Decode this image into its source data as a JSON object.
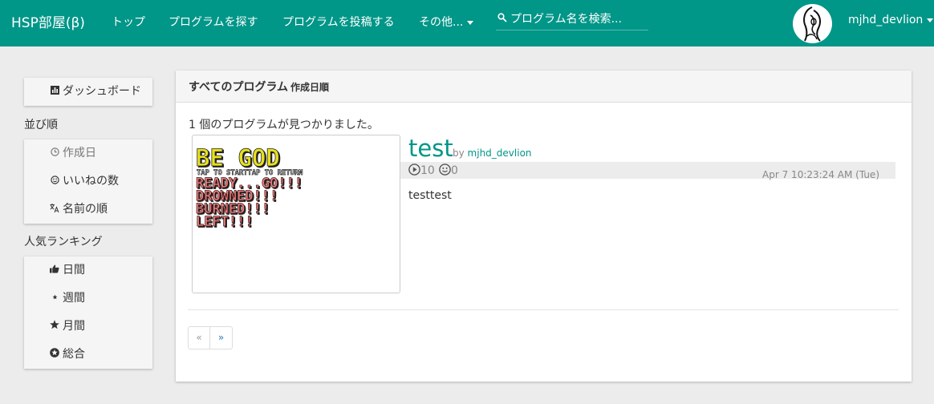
{
  "navbar": {
    "brand": "HSP部屋(β)",
    "links": [
      "トップ",
      "プログラムを探す",
      "プログラムを投稿する",
      "その他..."
    ],
    "search_placeholder": "プログラム名を検索...",
    "username": "mjhd_devlion"
  },
  "sidebar": {
    "dashboard": "ダッシュボード",
    "sort_heading": "並び順",
    "sort_items": [
      {
        "label": "作成日",
        "icon": "clock-icon"
      },
      {
        "label": "いいねの数",
        "icon": "smiley-icon"
      },
      {
        "label": "名前の順",
        "icon": "translate-icon"
      }
    ],
    "ranking_heading": "人気ランキング",
    "ranking_items": [
      {
        "label": "日間",
        "icon": "thumbs-up-icon"
      },
      {
        "label": "週間",
        "icon": "small-star-icon"
      },
      {
        "label": "月間",
        "icon": "star-icon"
      },
      {
        "label": "総合",
        "icon": "badge-star-icon"
      }
    ]
  },
  "main": {
    "title": "すべてのプログラム",
    "subtitle": "作成日順",
    "result_count": "1 個のプログラムが見つかりました。",
    "program": {
      "title": "test",
      "by": "by",
      "author": "mjhd_devlion",
      "plays": "10",
      "likes": "0",
      "date": "Apr 7 10:23:24 AM (Tue)",
      "description": "testtest",
      "thumbnail_lines": [
        "BE GOD",
        "TAP TO STARTTAP TO RETURN",
        "READY...GO!!!",
        "DROWNED!!!",
        "BURNED!!!",
        "LEFT!!!"
      ]
    },
    "pager": {
      "prev": "«",
      "next": "»"
    }
  },
  "colors": {
    "accent": "#009688",
    "background": "#ececec"
  }
}
